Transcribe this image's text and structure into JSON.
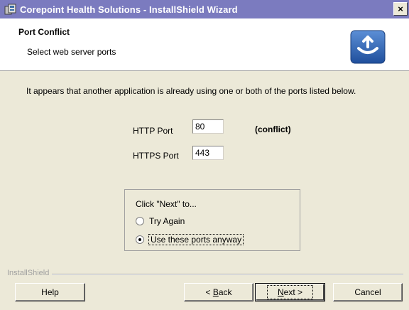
{
  "window": {
    "title": "Corepoint Health Solutions - InstallShield Wizard",
    "close_glyph": "×"
  },
  "header": {
    "title": "Port Conflict",
    "subtitle": "Select web server ports",
    "logo_icon": "installshield-logo-icon"
  },
  "body": {
    "message": "It appears that another application is already using one or both of the ports listed below."
  },
  "fields": {
    "http_label": "HTTP Port",
    "http_value": "80",
    "https_label": "HTTPS Port",
    "https_value": "443",
    "conflict_text": "(conflict)"
  },
  "options": {
    "title": "Click \"Next\" to...",
    "items": [
      {
        "label": "Try Again",
        "selected": false
      },
      {
        "label": "Use these ports anyway",
        "selected": true
      }
    ]
  },
  "footer": {
    "brand": "InstallShield",
    "help_label": "Help",
    "back_prefix": "< ",
    "back_key": "B",
    "back_rest": "ack",
    "next_key": "N",
    "next_rest": "ext >",
    "cancel_label": "Cancel"
  },
  "colors": {
    "titlebar": "#7b7bbf",
    "dialog_bg": "#ece9d8",
    "header_bg": "#ffffff"
  }
}
